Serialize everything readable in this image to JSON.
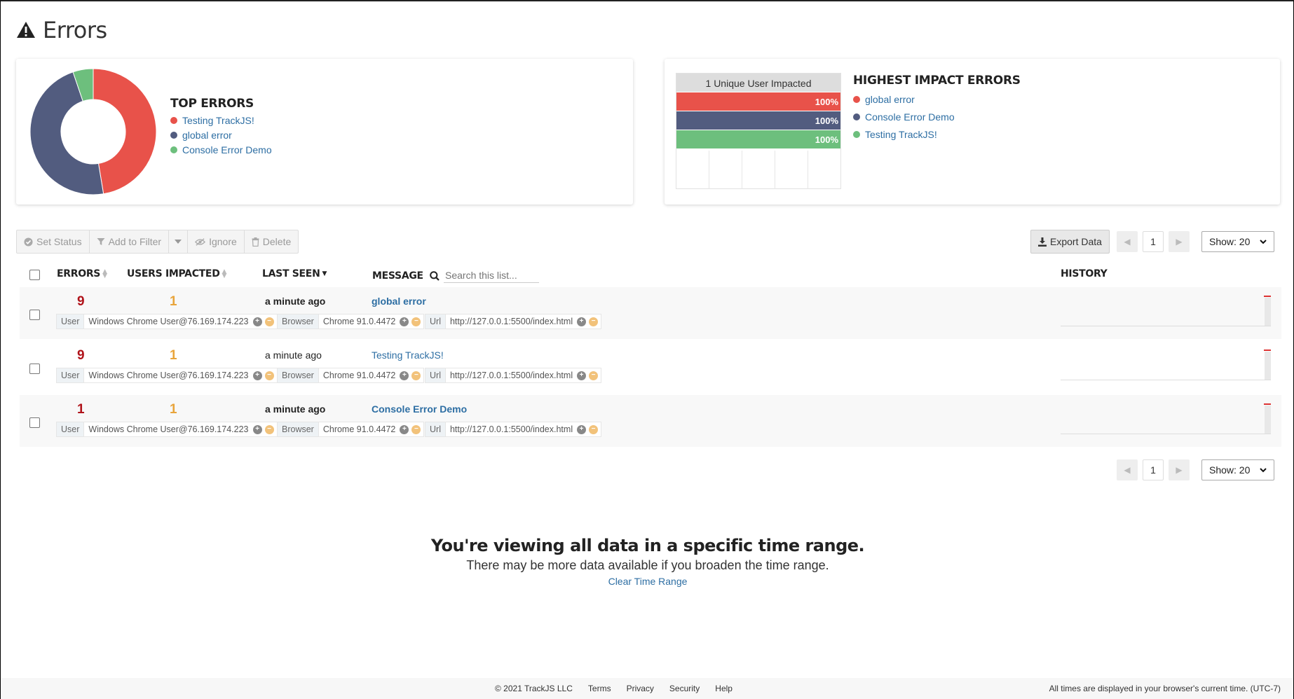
{
  "page": {
    "title": "Errors"
  },
  "top_errors": {
    "heading": "TOP ERRORS",
    "items": [
      {
        "label": "Testing TrackJS!",
        "color": "#e8524a",
        "share": 0.474
      },
      {
        "label": "global error",
        "color": "#525c7f",
        "share": 0.474
      },
      {
        "label": "Console Error Demo",
        "color": "#6dbf7d",
        "share": 0.052
      }
    ]
  },
  "impact": {
    "header": "1 Unique User Impacted",
    "heading": "HIGHEST IMPACT ERRORS",
    "bars": [
      {
        "value": "100%",
        "color": "#e8524a",
        "fraction": 1.0
      },
      {
        "value": "100%",
        "color": "#525c7f",
        "fraction": 1.0
      },
      {
        "value": "100%",
        "color": "#6dbf7d",
        "fraction": 1.0
      }
    ],
    "items": [
      {
        "label": "global error",
        "color": "#e8524a"
      },
      {
        "label": "Console Error Demo",
        "color": "#525c7f"
      },
      {
        "label": "Testing TrackJS!",
        "color": "#6dbf7d"
      }
    ]
  },
  "toolbar": {
    "set_status": "Set Status",
    "add_to_filter": "Add to Filter",
    "ignore": "Ignore",
    "delete": "Delete",
    "export": "Export Data"
  },
  "pagination": {
    "page": "1",
    "show": "Show: 20"
  },
  "table": {
    "headers": {
      "errors": "ERRORS",
      "users": "USERS IMPACTED",
      "last_seen": "LAST SEEN",
      "message": "MESSAGE",
      "history": "HISTORY"
    },
    "search_placeholder": "Search this list...",
    "rows": [
      {
        "errors": "9",
        "users": "1",
        "last_seen": "a minute ago",
        "message": "global error",
        "bold": true,
        "user_key": "User",
        "user_val": "Windows Chrome User@76.169.174.223",
        "browser_key": "Browser",
        "browser_val": "Chrome 91.0.4472",
        "url_key": "Url",
        "url_val": "http://127.0.0.1:5500/index.html"
      },
      {
        "errors": "9",
        "users": "1",
        "last_seen": "a minute ago",
        "message": "Testing TrackJS!",
        "bold": false,
        "user_key": "User",
        "user_val": "Windows Chrome User@76.169.174.223",
        "browser_key": "Browser",
        "browser_val": "Chrome 91.0.4472",
        "url_key": "Url",
        "url_val": "http://127.0.0.1:5500/index.html"
      },
      {
        "errors": "1",
        "users": "1",
        "last_seen": "a minute ago",
        "message": "Console Error Demo",
        "bold": true,
        "user_key": "User",
        "user_val": "Windows Chrome User@76.169.174.223",
        "browser_key": "Browser",
        "browser_val": "Chrome 91.0.4472",
        "url_key": "Url",
        "url_val": "http://127.0.0.1:5500/index.html"
      }
    ]
  },
  "notice": {
    "heading": "You're viewing all data in a specific time range.",
    "text": "There may be more data available if you broaden the time range.",
    "link": "Clear Time Range"
  },
  "footer": {
    "copyright": "© 2021 TrackJS LLC",
    "terms": "Terms",
    "privacy": "Privacy",
    "security": "Security",
    "help": "Help",
    "timezone": "All times are displayed in your browser's current time. (UTC-7)"
  }
}
